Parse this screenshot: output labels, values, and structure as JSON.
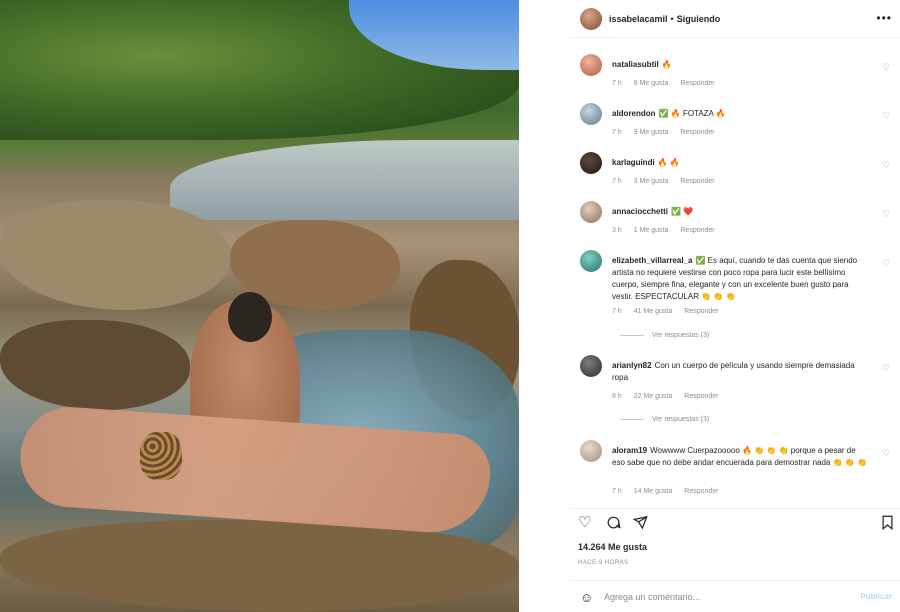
{
  "post": {
    "username": "issabelacamil",
    "separator": "•",
    "follow_status": "Siguiendo",
    "more_icon": "more-horizontal-icon"
  },
  "comments": [
    {
      "user": "nataliasubtil",
      "text": "🔥 ",
      "time": "7 h",
      "likes": "8 Me gusta",
      "reply": "Responder"
    },
    {
      "user": "aldorendon",
      "text": "✅ 🔥 FOTAZA 🔥",
      "time": "7 h",
      "likes": "9 Me gusta",
      "reply": "Responder"
    },
    {
      "user": "karlaguindi",
      "text": "🔥 🔥",
      "time": "7 h",
      "likes": "3 Me gusta",
      "reply": "Responder"
    },
    {
      "user": "annaciocchetti",
      "text": "✅ ❤️",
      "time": "3 h",
      "likes": "1 Me gusta",
      "reply": "Responder"
    },
    {
      "user": "elizabeth_villarreal_a",
      "text": "✅ Es aquí, cuando te das cuenta que siendo artista no requiere vestirse con poco ropa para lucir este bellísimo cuerpo, siempre fina, elegante y con un excelente buen gusto para vestir. ESPECTACULAR 👏 👏 👏",
      "time": "7 h",
      "likes": "41 Me gusta",
      "reply": "Responder",
      "replies": "Ver respuestas (3)"
    },
    {
      "user": "arianlyn82",
      "text": "Con un cuerpo de película y usando siempre demasiada ropa",
      "time": "8 h",
      "likes": "22 Me gusta",
      "reply": "Responder",
      "replies": "Ver respuestas (3)"
    },
    {
      "user": "aloram19",
      "text": "Wowwww Cuerpazooooo 🔥 👏 👏 👏 porque a pesar de eso sabe que no debe andar encuerada para demostrar nada 👏 👏 👏",
      "time": "7 h",
      "likes": "14 Me gusta",
      "reply": "Responder"
    }
  ],
  "actions": {
    "like_icon": "heart-icon",
    "comment_icon": "comment-icon",
    "share_icon": "send-icon",
    "save_icon": "bookmark-icon"
  },
  "likes_count": "14.264 Me gusta",
  "date": "HACE 9 HORAS",
  "add_comment": {
    "placeholder": "Agrega un comentario...",
    "publish_label": "Publicar",
    "emoji_icon": "smile-icon"
  }
}
